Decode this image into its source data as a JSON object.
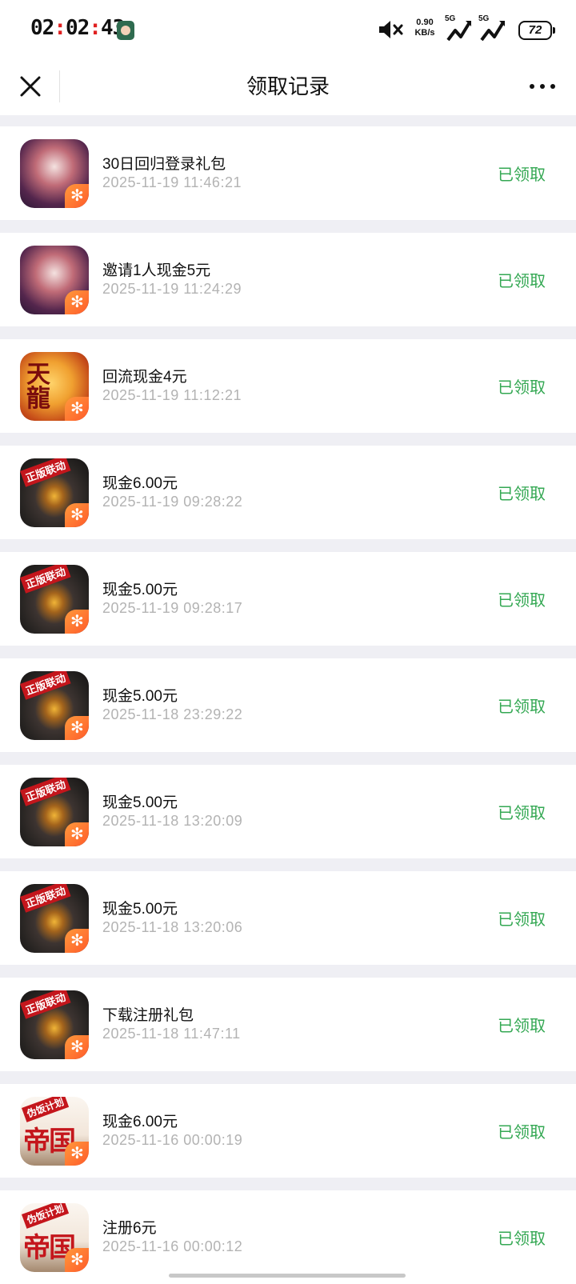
{
  "status_bar": {
    "time_h": "02",
    "time_m": "02",
    "time_s": "43",
    "net_speed": "0.90",
    "net_unit": "KB/s",
    "sig1": "5G",
    "sig2": "5G",
    "battery": "72"
  },
  "nav": {
    "title": "领取记录",
    "close_icon": "close-icon",
    "more_icon": "more-dots-icon"
  },
  "colors": {
    "status_claimed": "#34a853",
    "highlight": "#e02020"
  },
  "records": [
    {
      "title": "30日回归登录礼包",
      "date": "2025-11-19 11:46:21",
      "status": "已领取",
      "icon": "a"
    },
    {
      "title": "邀请1人现金5元",
      "date": "2025-11-19 11:24:29",
      "status": "已领取",
      "icon": "a"
    },
    {
      "title": "回流现金4元",
      "date": "2025-11-19 11:12:21",
      "status": "已领取",
      "icon": "b"
    },
    {
      "title": "现金6.00元",
      "date": "2025-11-19 09:28:22",
      "status": "已领取",
      "icon": "c"
    },
    {
      "title": "现金5.00元",
      "date": "2025-11-19 09:28:17",
      "status": "已领取",
      "icon": "c"
    },
    {
      "title": "现金5.00元",
      "date": "2025-11-18 23:29:22",
      "status": "已领取",
      "icon": "c"
    },
    {
      "title": "现金5.00元",
      "date": "2025-11-18 13:20:09",
      "status": "已领取",
      "icon": "c"
    },
    {
      "title": "现金5.00元",
      "date": "2025-11-18 13:20:06",
      "status": "已领取",
      "icon": "c"
    },
    {
      "title": "下载注册礼包",
      "date": "2025-11-18 11:47:11",
      "status": "已领取",
      "icon": "c"
    },
    {
      "title": "现金6.00元",
      "date": "2025-11-16 00:00:19",
      "status": "已领取",
      "icon": "d"
    },
    {
      "title": "注册6元",
      "date": "2025-11-16 00:00:12",
      "status": "已领取",
      "icon": "d"
    }
  ],
  "icon_labels": {
    "b": "天龍",
    "c": "正版联动",
    "d_tag": "伪饭计划",
    "d_big": "帝国"
  }
}
